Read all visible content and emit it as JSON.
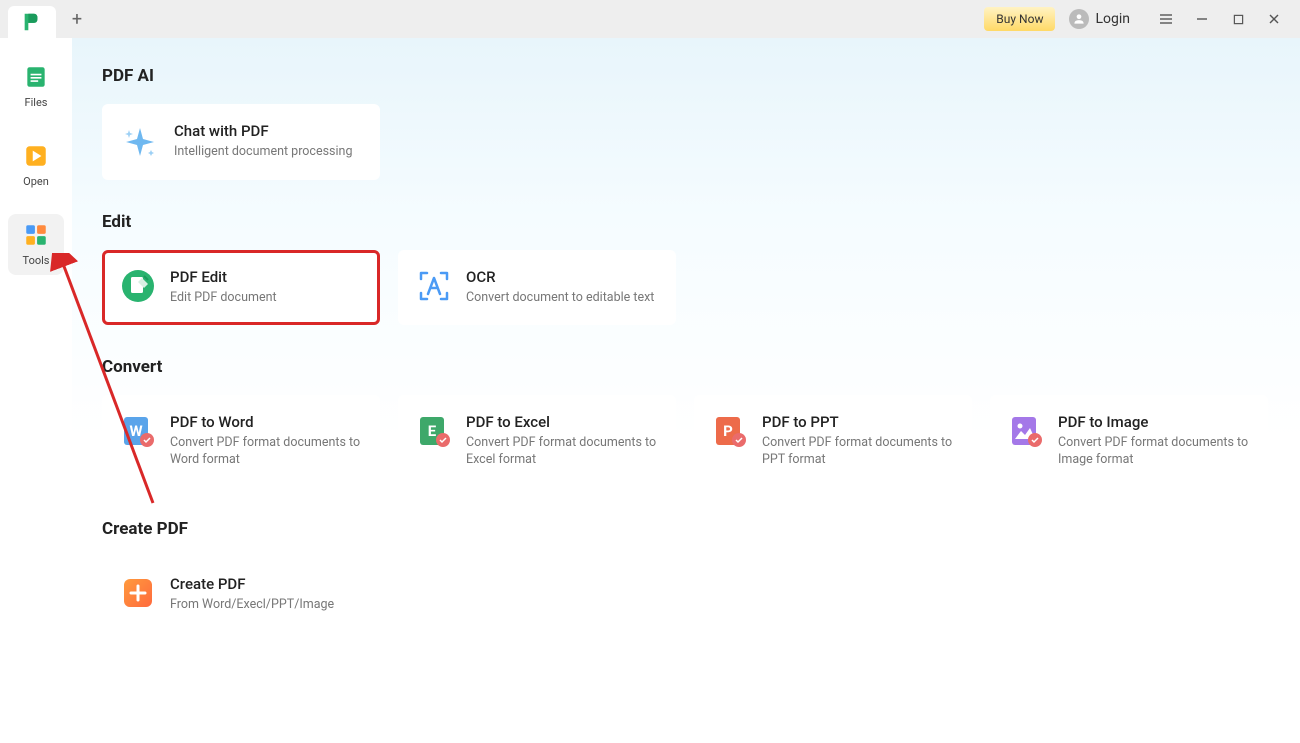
{
  "titlebar": {
    "buy_now": "Buy Now",
    "login": "Login"
  },
  "sidebar": {
    "items": [
      {
        "label": "Files"
      },
      {
        "label": "Open"
      },
      {
        "label": "Tools"
      }
    ]
  },
  "sections": {
    "pdf_ai": {
      "title": "PDF AI",
      "chat": {
        "title": "Chat with PDF",
        "desc": "Intelligent document processing"
      }
    },
    "edit": {
      "title": "Edit",
      "pdf_edit": {
        "title": "PDF Edit",
        "desc": "Edit PDF document"
      },
      "ocr": {
        "title": "OCR",
        "desc": "Convert document to editable text"
      }
    },
    "convert": {
      "title": "Convert",
      "word": {
        "title": "PDF to Word",
        "desc": "Convert PDF format documents to Word format"
      },
      "excel": {
        "title": "PDF to Excel",
        "desc": "Convert PDF format documents to Excel format"
      },
      "ppt": {
        "title": "PDF to PPT",
        "desc": "Convert PDF format documents to PPT format"
      },
      "image": {
        "title": "PDF to Image",
        "desc": "Convert PDF format documents to Image format"
      }
    },
    "create": {
      "title": "Create PDF",
      "create": {
        "title": "Create PDF",
        "desc": "From Word/Execl/PPT/Image"
      }
    }
  }
}
